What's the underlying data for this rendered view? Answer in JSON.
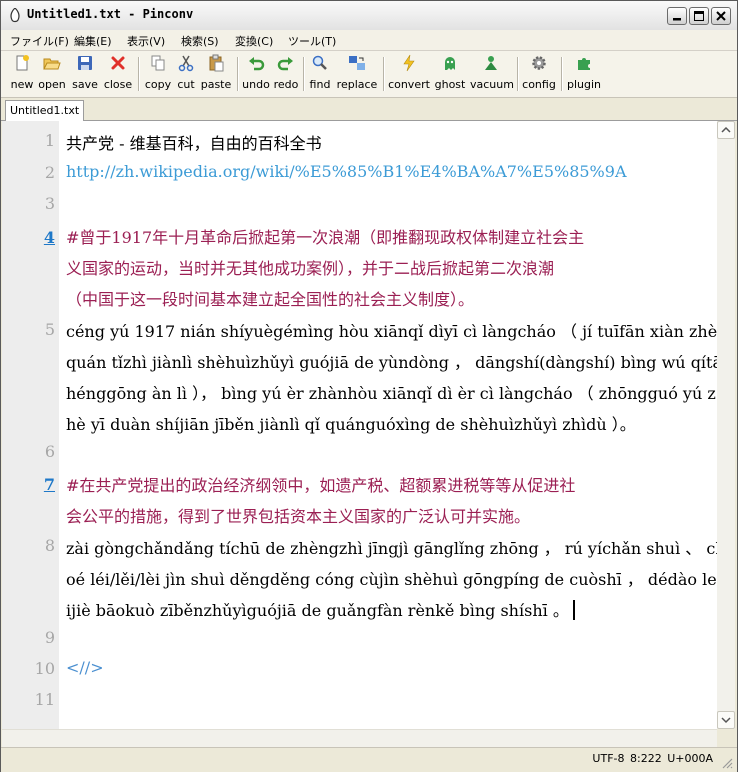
{
  "window": {
    "title": "Untitled1.txt - Pinconv"
  },
  "menu": [
    "ファイル(F)",
    "編集(E)",
    "表示(V)",
    "検索(S)",
    "変換(C)",
    "ツール(T)"
  ],
  "toolbar": {
    "new": "new",
    "open": "open",
    "save": "save",
    "close": "close",
    "copy": "copy",
    "cut": "cut",
    "paste": "paste",
    "undo": "undo",
    "redo": "redo",
    "find": "find",
    "replace": "replace",
    "convert": "convert",
    "ghost": "ghost",
    "vacuum": "vacuum",
    "config": "config",
    "plugin": "plugin"
  },
  "tabs": [
    {
      "label": "Untitled1.txt",
      "active": true
    }
  ],
  "editor": {
    "line_numbers": [
      "1",
      "2",
      "3",
      "4",
      "5",
      "6",
      "7",
      "8",
      "9",
      "10",
      "11"
    ],
    "active_lines": [
      "4",
      "7"
    ],
    "rows": [
      "共产党 - 维基百科，自由的百科全书",
      "http://zh.wikipedia.org/wiki/%E5%85%B1%E4%BA%A7%E5%85%9A",
      "",
      "#曾于1917年十月革命后掀起第一次浪潮（即推翻现政权体制建立社会主",
      "义国家的运动，当时并无其他成功案例），并于二战后掀起第二次浪潮",
      "（中国于这一段时间基本建立起全国性的社会主义制度）。",
      "céng yú 1917 nián shíyuègémìng hòu xiānqǐ dìyī cì làngcháo （ jí tuīfān xiàn zhèng",
      "quán tǐzhì jiànlì shèhuìzhǔyì guójiā de yùndòng ， dāngshí(dàngshí) bìng wú qítā c",
      "hénggōng àn lì ）， bìng yú èr zhànhòu xiānqǐ dì èr cì làngcháo （ zhōngguó yú z",
      "hè yī duàn shíjiān jīběn jiànlì qǐ quánguóxìng de shèhuìzhǔyì zhìdù ）。",
      "",
      "#在共产党提出的政治经济纲领中，如遗产税、超额累进税等等从促进社",
      "会公平的措施，得到了世界包括资本主义国家的广泛认可并实施。",
      "zài gòngchǎndǎng tíchū de zhèngzhì jīngjì gānglǐng zhōng ， rú yíchǎn shuì 、 chā",
      "oé léi/lěi/lèi jìn shuì děngděng cóng cùjìn shèhuì gōngpíng de cuòshī ， dédào le sh",
      "ijiè bāokuò zīběnzhǔyìguójiā de guǎngfàn rènkě bìng shíshī 。",
      "",
      "<//>",
      ""
    ]
  },
  "status": {
    "encoding": "UTF-8",
    "position": "8:222",
    "codepoint": "U+000A"
  }
}
